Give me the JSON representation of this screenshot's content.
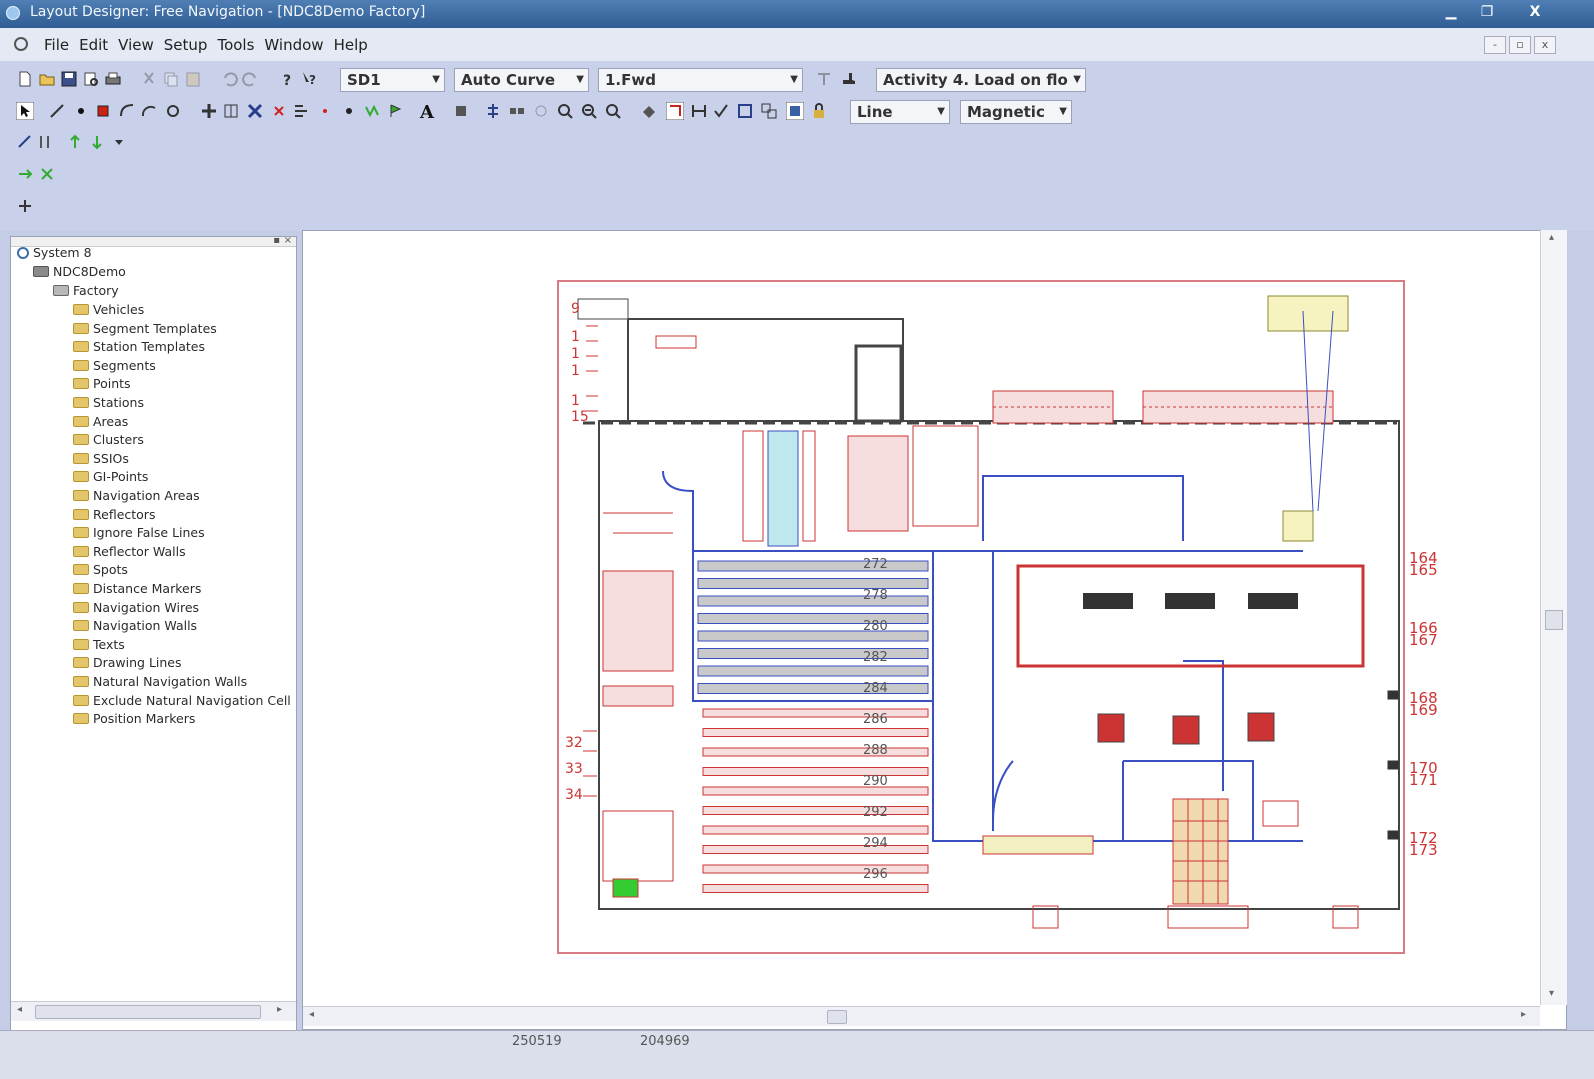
{
  "window": {
    "title": "Layout Designer: Free Navigation - [NDC8Demo Factory]",
    "controls": [
      "▁",
      "❐",
      "X"
    ]
  },
  "menubar": {
    "items": [
      "File",
      "Edit",
      "View",
      "Setup",
      "Tools",
      "Window",
      "Help"
    ],
    "mdi_controls": [
      "-",
      "▫",
      "x"
    ]
  },
  "toolbar": {
    "segment_selector": "SD1",
    "curve_selector": "Auto Curve",
    "direction_selector": "1.Fwd",
    "activity_selector": "Activity 4. Load on flo",
    "line_selector": "Line",
    "snap_selector": "Magnetic"
  },
  "tree": {
    "root": "System 8",
    "project": "NDC8Demo",
    "group": "Factory",
    "items": [
      "Vehicles",
      "Segment Templates",
      "Station Templates",
      "Segments",
      "Points",
      "Stations",
      "Areas",
      "Clusters",
      "SSIOs",
      "GI-Points",
      "Navigation Areas",
      "Reflectors",
      "Ignore False Lines",
      "Reflector Walls",
      "Spots",
      "Distance Markers",
      "Navigation Wires",
      "Navigation Walls",
      "Texts",
      "Drawing Lines",
      "Natural Navigation Walls",
      "Exclude Natural Navigation Cell",
      "Position Markers"
    ]
  },
  "drawing": {
    "left_labels": [
      "9",
      "1",
      "1",
      "1",
      "1",
      "15",
      "32",
      "33",
      "34"
    ],
    "right_labels": [
      "164",
      "165",
      "166",
      "167",
      "168",
      "169",
      "170",
      "171",
      "172",
      "173"
    ],
    "rack_labels": [
      "272",
      "278",
      "280",
      "282",
      "284",
      "286",
      "288",
      "290",
      "292",
      "294",
      "296"
    ]
  },
  "status": {
    "x": "250519",
    "y": "204969"
  }
}
